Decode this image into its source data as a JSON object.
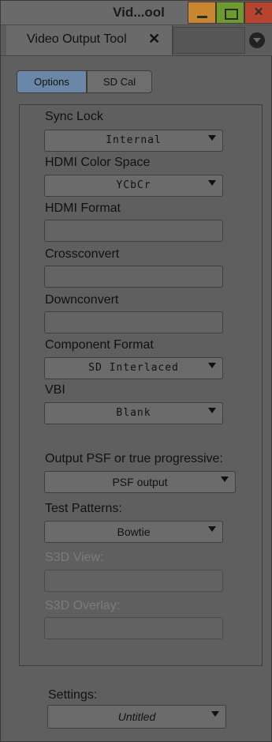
{
  "window": {
    "title": "Vid...ool",
    "minimize_icon": "minimize-icon",
    "maximize_icon": "maximize-icon",
    "close_icon": "close-icon",
    "colors": {
      "minimize": "#c9862e",
      "maximize": "#6f9a2c",
      "close": "#b7442f"
    }
  },
  "tab": {
    "label": "Video Output Tool",
    "close_glyph": "✕",
    "menu_icon": "tab-menu-icon"
  },
  "subtabs": [
    "Options",
    "SD Cal"
  ],
  "fields": [
    {
      "label": "Sync Lock",
      "value": "Internal",
      "enabled": true
    },
    {
      "label": "HDMI Color Space",
      "value": "YCbCr",
      "enabled": true
    },
    {
      "label": "HDMI Format",
      "value": "",
      "enabled": true
    },
    {
      "label": "Crossconvert",
      "value": "",
      "enabled": true
    },
    {
      "label": "Downconvert",
      "value": "",
      "enabled": true
    },
    {
      "label": "Component Format",
      "value": "SD Interlaced",
      "enabled": true
    },
    {
      "label": "VBI",
      "value": "Blank",
      "enabled": true
    },
    {
      "label": "Output PSF or true progressive:",
      "value": "PSF output",
      "enabled": true
    },
    {
      "label": "Test Patterns:",
      "value": "Bowtie",
      "enabled": true
    },
    {
      "label": "S3D View:",
      "value": "",
      "enabled": false
    },
    {
      "label": "S3D Overlay:",
      "value": "",
      "enabled": false
    }
  ],
  "settings": {
    "label": "Settings:",
    "value": "Untitled"
  },
  "accent_color": "#6a87a8"
}
